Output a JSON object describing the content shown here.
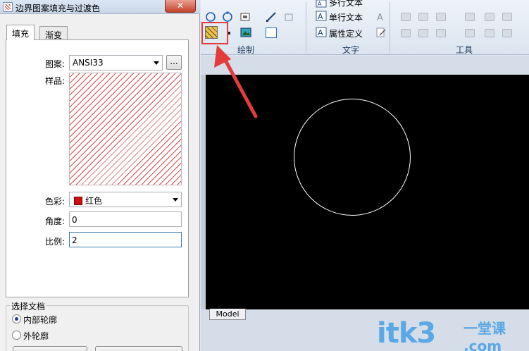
{
  "dialog": {
    "title": "边界图案填充与过渡色",
    "close_label": "✕",
    "tabs": [
      {
        "label": "填充",
        "active": true
      },
      {
        "label": "渐变",
        "active": false
      }
    ],
    "pattern": {
      "label": "图案:",
      "value": "ANSI33",
      "browse_label": "..."
    },
    "sample": {
      "label": "样品:"
    },
    "color": {
      "label": "色彩:",
      "value": "红色",
      "swatch": "#cc1010"
    },
    "angle": {
      "label": "角度:",
      "value": "0"
    },
    "scale": {
      "label": "比例:",
      "value": "2"
    },
    "select_group": {
      "title": "选择文档",
      "options": [
        {
          "label": "内部轮廓",
          "selected": true
        },
        {
          "label": "外轮廓",
          "selected": false
        }
      ]
    }
  },
  "ribbon": {
    "groups": [
      {
        "label": "绘制"
      },
      {
        "label": "文字"
      },
      {
        "label": "工具"
      }
    ],
    "text_tools": [
      {
        "label": "多行文本",
        "icon": "mtext-icon"
      },
      {
        "label": "单行文本",
        "icon": "text-icon"
      },
      {
        "label": "属性定义",
        "icon": "attribute-icon"
      }
    ],
    "highlighted_tool": "hatch-icon"
  },
  "canvas": {
    "model_tab": "Model",
    "background": "#000000"
  },
  "watermark": {
    "text": "itk3",
    "sub": "一堂课 .com"
  },
  "annotation": {
    "color": "#e43b3b"
  }
}
